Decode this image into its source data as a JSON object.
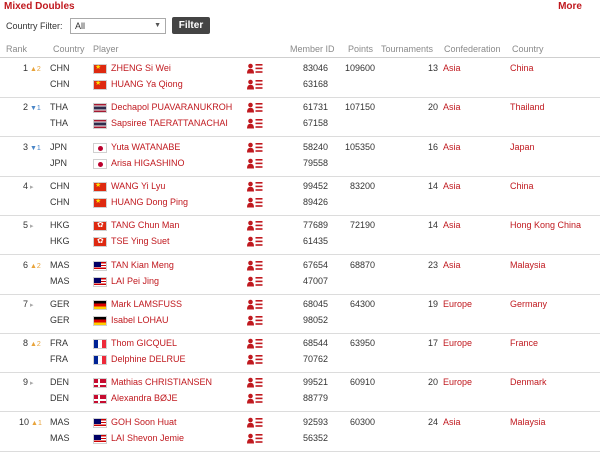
{
  "header": {
    "title": "Mixed Doubles",
    "more": "More"
  },
  "filter": {
    "label": "Country Filter:",
    "selected": "All",
    "button": "Filter"
  },
  "columns": {
    "rank": "Rank",
    "country": "Country",
    "player": "Player",
    "member_id": "Member ID",
    "points": "Points",
    "tournaments": "Tournaments",
    "confederation": "Confederation",
    "country_name": "Country"
  },
  "colors": {
    "accent": "#c0191f",
    "up": "#e8a33a",
    "down": "#4a86c8"
  },
  "icons": {
    "profile": "person-list-icon",
    "move_up": "triangle-up-icon",
    "move_down": "triangle-down-icon",
    "no_change": "triangle-right-icon",
    "dropdown": "chevron-down-icon"
  },
  "rankings": [
    {
      "rank": "1",
      "move": "up",
      "move_text": "▲2",
      "points": "109600",
      "tournaments": "13",
      "confederation": "Asia",
      "country_name": "China",
      "players": [
        {
          "country": "CHN",
          "flag": "chn",
          "name": "ZHENG Si Wei",
          "member_id": "83046"
        },
        {
          "country": "CHN",
          "flag": "chn",
          "name": "HUANG Ya Qiong",
          "member_id": "63168"
        }
      ]
    },
    {
      "rank": "2",
      "move": "down",
      "move_text": "▼1",
      "points": "107150",
      "tournaments": "20",
      "confederation": "Asia",
      "country_name": "Thailand",
      "players": [
        {
          "country": "THA",
          "flag": "tha",
          "name": "Dechapol PUAVARANUKROH",
          "member_id": "61731"
        },
        {
          "country": "THA",
          "flag": "tha",
          "name": "Sapsiree TAERATTANACHAI",
          "member_id": "67158"
        }
      ]
    },
    {
      "rank": "3",
      "move": "down",
      "move_text": "▼1",
      "points": "105350",
      "tournaments": "16",
      "confederation": "Asia",
      "country_name": "Japan",
      "players": [
        {
          "country": "JPN",
          "flag": "jpn",
          "name": "Yuta WATANABE",
          "member_id": "58240"
        },
        {
          "country": "JPN",
          "flag": "jpn",
          "name": "Arisa HIGASHINO",
          "member_id": "79558"
        }
      ]
    },
    {
      "rank": "4",
      "move": "same",
      "move_text": "▸",
      "points": "83200",
      "tournaments": "14",
      "confederation": "Asia",
      "country_name": "China",
      "players": [
        {
          "country": "CHN",
          "flag": "chn",
          "name": "WANG Yi Lyu",
          "member_id": "99452"
        },
        {
          "country": "CHN",
          "flag": "chn",
          "name": "HUANG Dong Ping",
          "member_id": "89426"
        }
      ]
    },
    {
      "rank": "5",
      "move": "same",
      "move_text": "▸",
      "points": "72190",
      "tournaments": "14",
      "confederation": "Asia",
      "country_name": "Hong Kong China",
      "players": [
        {
          "country": "HKG",
          "flag": "hkg",
          "name": "TANG Chun Man",
          "member_id": "77689"
        },
        {
          "country": "HKG",
          "flag": "hkg",
          "name": "TSE Ying Suet",
          "member_id": "61435"
        }
      ]
    },
    {
      "rank": "6",
      "move": "up",
      "move_text": "▲2",
      "points": "68870",
      "tournaments": "23",
      "confederation": "Asia",
      "country_name": "Malaysia",
      "players": [
        {
          "country": "MAS",
          "flag": "mas",
          "name": "TAN Kian Meng",
          "member_id": "67654"
        },
        {
          "country": "MAS",
          "flag": "mas",
          "name": "LAI Pei Jing",
          "member_id": "47007"
        }
      ]
    },
    {
      "rank": "7",
      "move": "same",
      "move_text": "▸",
      "points": "64300",
      "tournaments": "19",
      "confederation": "Europe",
      "country_name": "Germany",
      "players": [
        {
          "country": "GER",
          "flag": "ger",
          "name": "Mark LAMSFUSS",
          "member_id": "68045"
        },
        {
          "country": "GER",
          "flag": "ger",
          "name": "Isabel LOHAU",
          "member_id": "98052"
        }
      ]
    },
    {
      "rank": "8",
      "move": "up",
      "move_text": "▲2",
      "points": "63950",
      "tournaments": "17",
      "confederation": "Europe",
      "country_name": "France",
      "players": [
        {
          "country": "FRA",
          "flag": "fra",
          "name": "Thom GICQUEL",
          "member_id": "68544"
        },
        {
          "country": "FRA",
          "flag": "fra",
          "name": "Delphine DELRUE",
          "member_id": "70762"
        }
      ]
    },
    {
      "rank": "9",
      "move": "same",
      "move_text": "▸",
      "points": "60910",
      "tournaments": "20",
      "confederation": "Europe",
      "country_name": "Denmark",
      "players": [
        {
          "country": "DEN",
          "flag": "den",
          "name": "Mathias CHRISTIANSEN",
          "member_id": "99521"
        },
        {
          "country": "DEN",
          "flag": "den",
          "name": "Alexandra BØJE",
          "member_id": "88779"
        }
      ]
    },
    {
      "rank": "10",
      "move": "up",
      "move_text": "▲1",
      "points": "60300",
      "tournaments": "24",
      "confederation": "Asia",
      "country_name": "Malaysia",
      "players": [
        {
          "country": "MAS",
          "flag": "mas",
          "name": "GOH Soon Huat",
          "member_id": "92593"
        },
        {
          "country": "MAS",
          "flag": "mas",
          "name": "LAI Shevon Jemie",
          "member_id": "56352"
        }
      ]
    }
  ]
}
